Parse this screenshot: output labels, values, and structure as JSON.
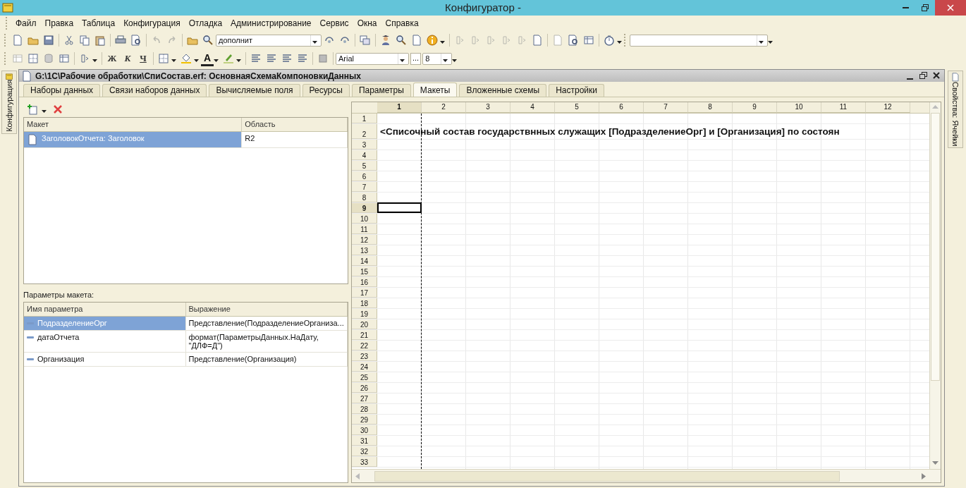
{
  "window": {
    "title": "Конфигуратор -"
  },
  "menu": [
    {
      "label": "Файл"
    },
    {
      "label": "Правка"
    },
    {
      "label": "Таблица"
    },
    {
      "label": "Конфигурация"
    },
    {
      "label": "Отладка"
    },
    {
      "label": "Администрирование"
    },
    {
      "label": "Сервис"
    },
    {
      "label": "Окна"
    },
    {
      "label": "Справка"
    }
  ],
  "search_field": {
    "value": "дополнит"
  },
  "format_buttons": [
    {
      "label": "Ж",
      "kind": "bold"
    },
    {
      "label": "К",
      "kind": "italic"
    },
    {
      "label": "Ч",
      "kind": "underline"
    }
  ],
  "font_color_button": {
    "label": "A"
  },
  "font_field": {
    "value": "Arial"
  },
  "font_more_button": {
    "label": "..."
  },
  "font_size_field": {
    "value": "8"
  },
  "left_side_tab": {
    "label": "Конфигурация"
  },
  "right_side_tab": {
    "label": "Свойства: Ячейки"
  },
  "document": {
    "title": "G:\\1C\\Рабочие обработки\\СпиСостав.erf: ОсновнаяСхемаКомпоновкиДанных",
    "tabs": [
      {
        "label": "Наборы данных",
        "selected": false
      },
      {
        "label": "Связи наборов данных",
        "selected": false
      },
      {
        "label": "Вычисляемые поля",
        "selected": false
      },
      {
        "label": "Ресурсы",
        "selected": false
      },
      {
        "label": "Параметры",
        "selected": false
      },
      {
        "label": "Макеты",
        "selected": true
      },
      {
        "label": "Вложенные схемы",
        "selected": false
      },
      {
        "label": "Настройки",
        "selected": false
      }
    ]
  },
  "templates": {
    "columns": [
      "Макет",
      "Область"
    ],
    "rows": [
      {
        "name": "ЗаголовокОтчета: Заголовок",
        "area": "R2",
        "selected": true
      }
    ]
  },
  "parameters": {
    "label": "Параметры макета:",
    "columns": [
      "Имя параметра",
      "Выражение"
    ],
    "rows": [
      {
        "name": "ПодразделениеОрг",
        "expression": "Представление(ПодразделениеОрганиза...",
        "selected": true
      },
      {
        "name": "датаОтчета",
        "expression": "формат(ПараметрыДанных.НаДату, \"ДЛФ=Д\")",
        "selected": false
      },
      {
        "name": "Организация",
        "expression": "Представление(Организация)",
        "selected": false
      }
    ]
  },
  "spreadsheet": {
    "columns": [
      {
        "label": "1",
        "selected": true
      },
      {
        "label": "2",
        "selected": false
      },
      {
        "label": "3",
        "selected": false
      },
      {
        "label": "4",
        "selected": false
      },
      {
        "label": "5",
        "selected": false
      },
      {
        "label": "6",
        "selected": false
      },
      {
        "label": "7",
        "selected": false
      },
      {
        "label": "8",
        "selected": false
      },
      {
        "label": "9",
        "selected": false
      },
      {
        "label": "10",
        "selected": false
      },
      {
        "label": "11",
        "selected": false
      },
      {
        "label": "12",
        "selected": false
      }
    ],
    "rows": [
      {
        "label": "1",
        "selected": false
      },
      {
        "label": "2",
        "selected": false,
        "text": "<Списочный состав государствнных служащих [ПодразделениеОрг] и [Организация] по состоян"
      },
      {
        "label": "3",
        "selected": false
      },
      {
        "label": "4",
        "selected": false
      },
      {
        "label": "5",
        "selected": false
      },
      {
        "label": "6",
        "selected": false
      },
      {
        "label": "7",
        "selected": false
      },
      {
        "label": "8",
        "selected": false
      },
      {
        "label": "9",
        "selected": true
      },
      {
        "label": "10",
        "selected": false
      },
      {
        "label": "11",
        "selected": false
      },
      {
        "label": "12",
        "selected": false
      },
      {
        "label": "13",
        "selected": false
      },
      {
        "label": "14",
        "selected": false
      },
      {
        "label": "15",
        "selected": false
      },
      {
        "label": "16",
        "selected": false
      },
      {
        "label": "17",
        "selected": false
      },
      {
        "label": "18",
        "selected": false
      },
      {
        "label": "19",
        "selected": false
      },
      {
        "label": "20",
        "selected": false
      },
      {
        "label": "21",
        "selected": false
      },
      {
        "label": "22",
        "selected": false
      },
      {
        "label": "23",
        "selected": false
      },
      {
        "label": "24",
        "selected": false
      },
      {
        "label": "25",
        "selected": false
      },
      {
        "label": "26",
        "selected": false
      },
      {
        "label": "27",
        "selected": false
      },
      {
        "label": "28",
        "selected": false
      },
      {
        "label": "29",
        "selected": false
      },
      {
        "label": "30",
        "selected": false
      },
      {
        "label": "31",
        "selected": false
      },
      {
        "label": "32",
        "selected": false
      },
      {
        "label": "33",
        "selected": false
      }
    ]
  }
}
